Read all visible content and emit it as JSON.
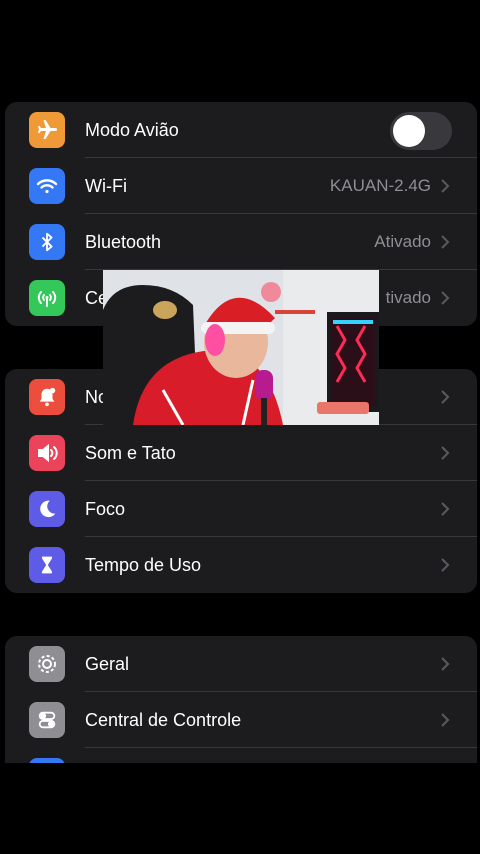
{
  "groups": [
    {
      "items": [
        {
          "label": "Modo Avião",
          "icon": "airplane-icon",
          "color": "#f09a37",
          "toggle": false
        },
        {
          "label": "Wi-Fi",
          "value": "KAUAN-2.4G",
          "icon": "wifi-icon",
          "color": "#3478f6"
        },
        {
          "label": "Bluetooth",
          "value": "Ativado",
          "icon": "bluetooth-icon",
          "color": "#3478f6"
        },
        {
          "label": "Ce",
          "value": "tivado",
          "icon": "cellular-icon",
          "color": "#34c759"
        }
      ]
    },
    {
      "items": [
        {
          "label": "No",
          "icon": "bell-icon",
          "color": "#eb4e3d"
        },
        {
          "label": "Som e Tato",
          "icon": "speaker-icon",
          "color": "#eb445a"
        },
        {
          "label": "Foco",
          "icon": "moon-icon",
          "color": "#5e5ce6"
        },
        {
          "label": "Tempo de Uso",
          "icon": "hourglass-icon",
          "color": "#5e5ce6"
        }
      ]
    },
    {
      "items": [
        {
          "label": "Geral",
          "icon": "gear-icon",
          "color": "#8e8e93"
        },
        {
          "label": "Central de Controle",
          "icon": "toggles-icon",
          "color": "#8e8e93"
        },
        {
          "label": "",
          "icon": "display-icon",
          "color": "#3478f6"
        }
      ]
    }
  ]
}
